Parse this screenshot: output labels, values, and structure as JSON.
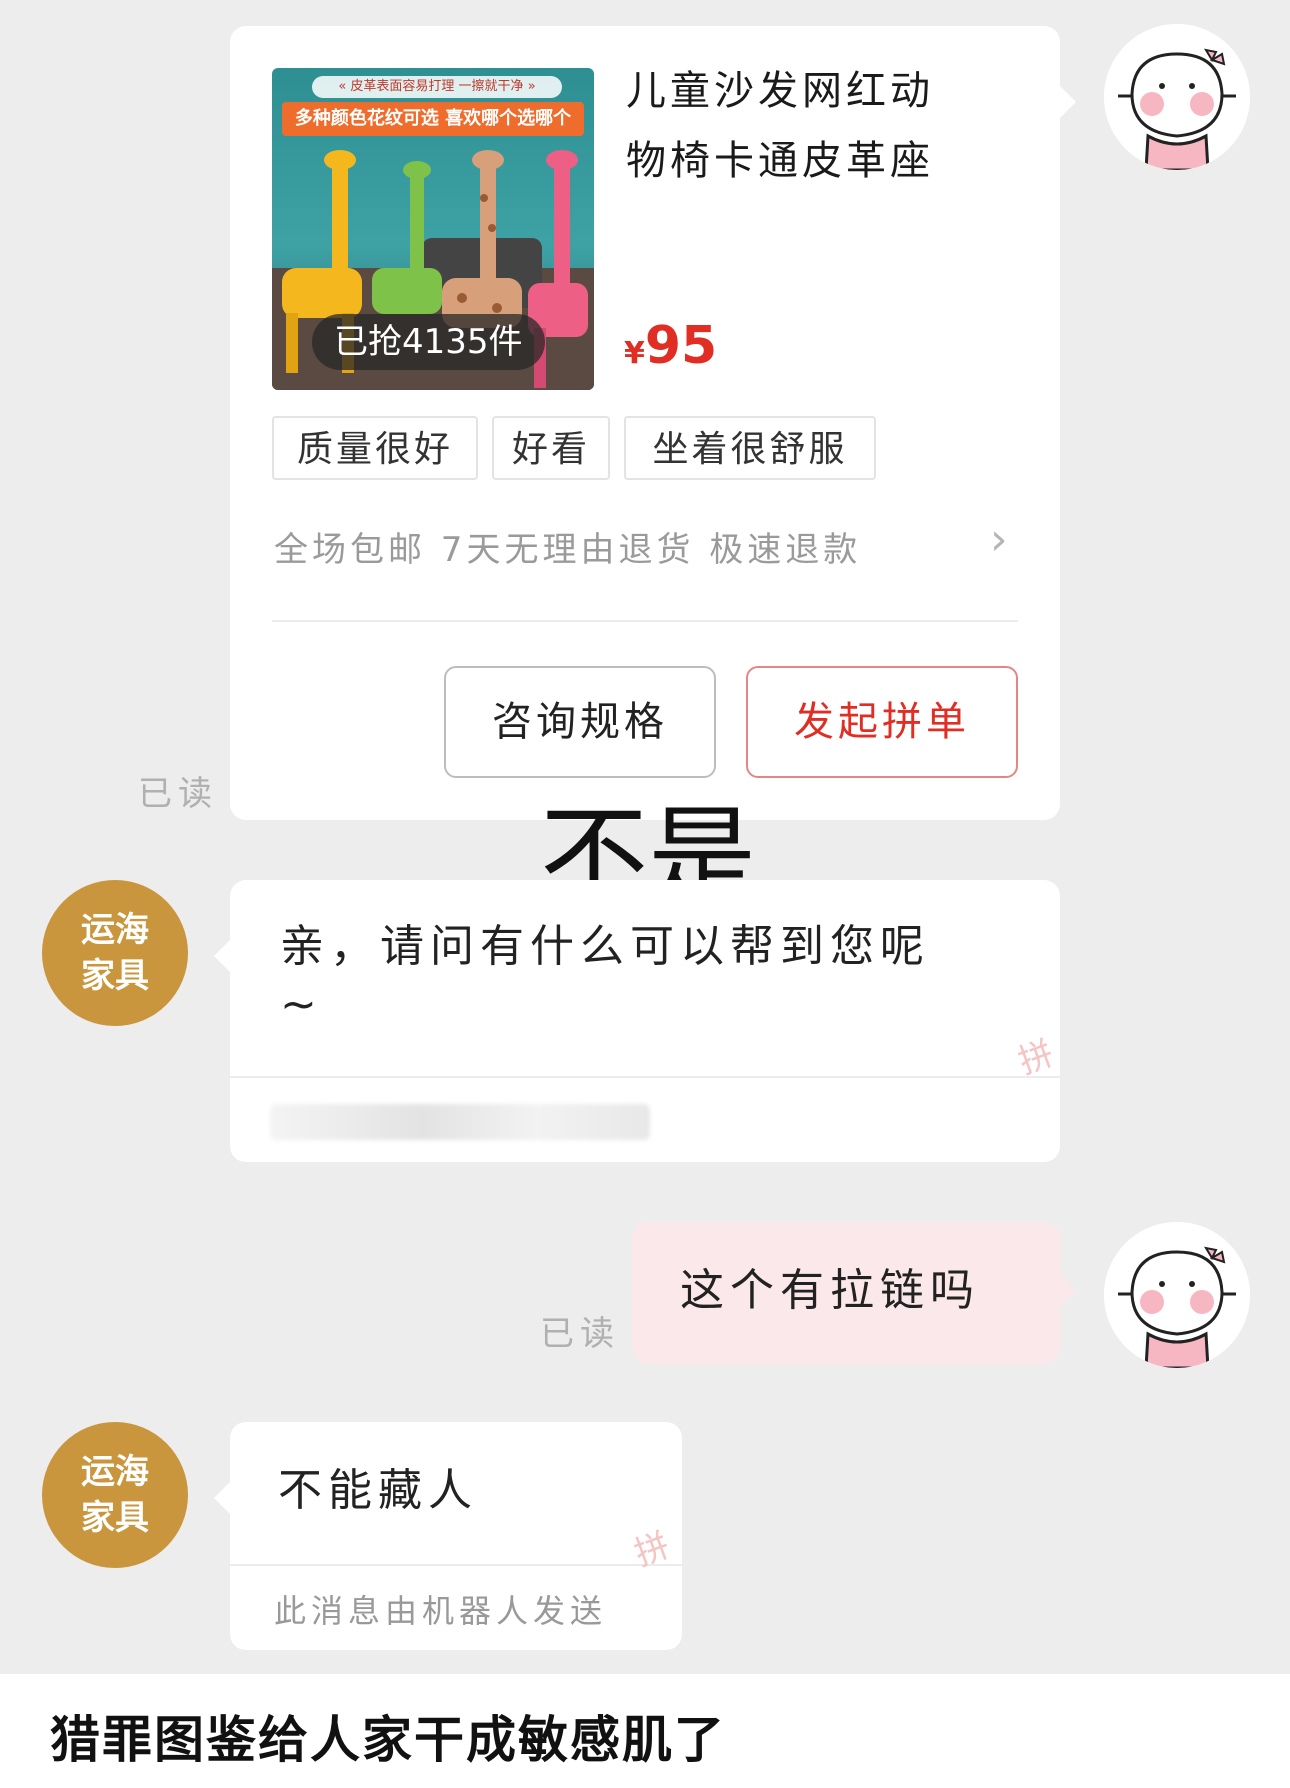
{
  "product_card": {
    "image": {
      "banner_top": "« 皮革表面容易打理 一擦就干净 »",
      "banner_main": "多种颜色花纹可选 喜欢哪个选哪个",
      "sold_badge": "已抢4135件"
    },
    "title_line1": "儿童沙发网红动",
    "title_line2": "物椅卡通皮革座",
    "price_symbol": "¥",
    "price_value": "95",
    "tags": [
      "质量很好",
      "好看",
      "坐着很舒服"
    ],
    "promo": "全场包邮 7天无理由退货 极速退款",
    "consult_button": "咨询规格",
    "group_buy_button": "发起拼单",
    "read_status": "已读"
  },
  "overlay_caption": "不是",
  "messages": [
    {
      "sender": "运海家具",
      "sender_line1": "运海",
      "sender_line2": "家具",
      "text_line1": "亲，请问有什么可以帮到您呢",
      "text_line2": "~"
    },
    {
      "sender": "user",
      "text": "这个有拉链吗",
      "read_status": "已读"
    },
    {
      "sender": "运海家具",
      "sender_line1": "运海",
      "sender_line2": "家具",
      "text": "不能藏人",
      "robot_note": "此消息由机器人发送"
    }
  ],
  "watermark_char": "拼",
  "bottom_caption": "猎罪图鉴给人家干成敏感肌了",
  "icons": {
    "chevron": "›"
  },
  "colors": {
    "background": "#ededed",
    "price_red": "#e02e24",
    "shop_avatar": "#c9963d",
    "user_bubble": "#fbe8ea"
  }
}
